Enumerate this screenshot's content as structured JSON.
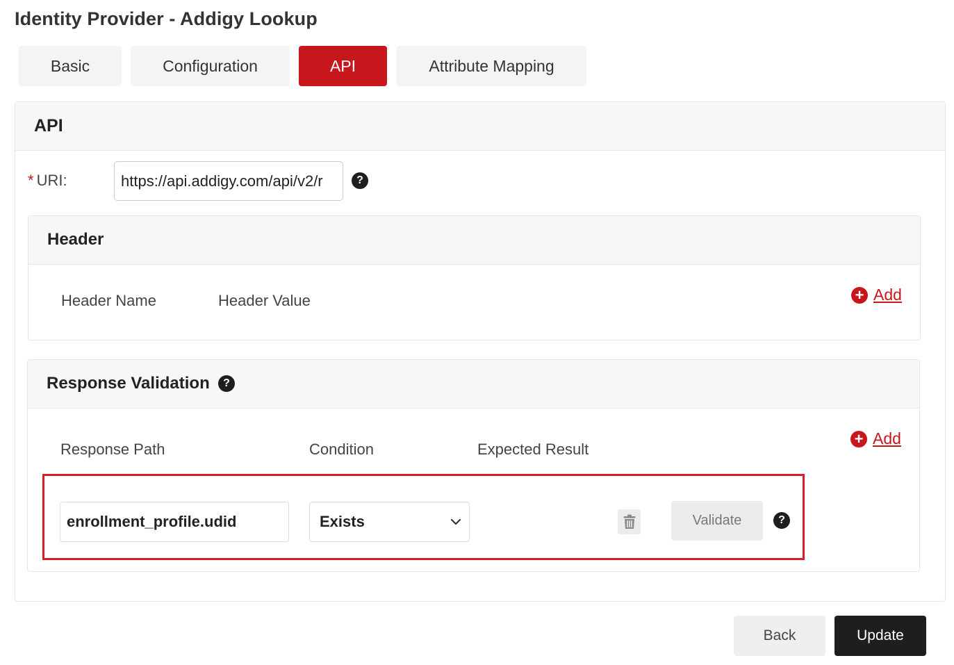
{
  "page": {
    "title": "Identity Provider - Addigy Lookup"
  },
  "tabs": [
    {
      "label": "Basic",
      "active": false
    },
    {
      "label": "Configuration",
      "active": false
    },
    {
      "label": "API",
      "active": true
    },
    {
      "label": "Attribute Mapping",
      "active": false
    }
  ],
  "api": {
    "title": "API",
    "uri_required_marker": "*",
    "uri_label": "URI:",
    "uri_value": "https://api.addigy.com/api/v2/r",
    "help_icon": "question-circle-icon"
  },
  "header_section": {
    "title": "Header",
    "columns": [
      "Header Name",
      "Header Value"
    ],
    "add_label": "Add",
    "add_icon": "plus-circle-icon"
  },
  "response_validation": {
    "title": "Response Validation",
    "help_icon": "question-circle-icon",
    "columns": [
      "Response Path",
      "Condition",
      "Expected Result"
    ],
    "add_label": "Add",
    "add_icon": "plus-circle-icon",
    "row": {
      "response_path": "enrollment_profile.udid",
      "condition": "Exists",
      "delete_icon": "trash-icon",
      "validate_label": "Validate"
    }
  },
  "footer": {
    "back_label": "Back",
    "update_label": "Update"
  },
  "colors": {
    "accent": "#c8161d",
    "dark_button": "#1e1e1e",
    "highlight": "#d81e26"
  }
}
